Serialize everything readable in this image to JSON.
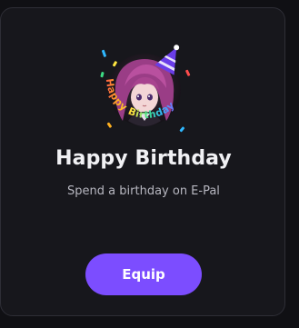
{
  "card": {
    "badge_icon": "birthday-avatar-badge-icon",
    "badge_text": "Happy Birthday",
    "title": "Happy Birthday",
    "subtitle": "Spend a birthday on E-Pal",
    "equip_label": "Equip"
  },
  "colors": {
    "page_background": "#101014",
    "card_background": "#17171c",
    "card_border": "#2e2e36",
    "accent": "#7c4dff",
    "title_text": "#f1f1f4",
    "subtitle_text": "#b7b7c0"
  }
}
